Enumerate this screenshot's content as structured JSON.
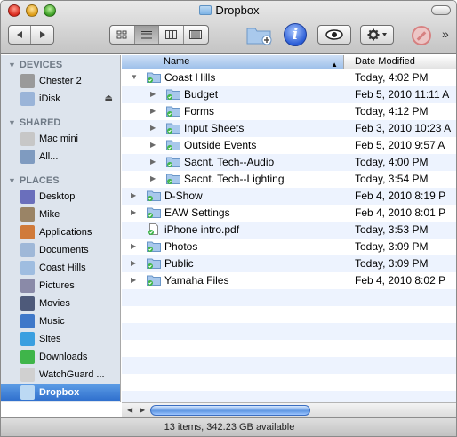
{
  "window": {
    "title": "Dropbox",
    "status": "13 items, 342.23 GB available"
  },
  "toolbar": {
    "back_icon": "triangle-left",
    "forward_icon": "triangle-right",
    "view_modes": [
      "icon-view",
      "list-view",
      "column-view",
      "cover-flow-view"
    ],
    "selected_view": "list-view",
    "more_label": "»"
  },
  "sidebar": {
    "sections": [
      {
        "heading": "DEVICES",
        "items": [
          {
            "label": "Chester 2",
            "icon": "hard-disk-icon",
            "color": "#9a9a9a"
          },
          {
            "label": "iDisk",
            "icon": "idisk-icon",
            "color": "#9ab4d8",
            "eject": "⏏"
          }
        ]
      },
      {
        "heading": "SHARED",
        "items": [
          {
            "label": "Mac mini",
            "icon": "mac-mini-icon",
            "color": "#c7c7c7"
          },
          {
            "label": "All...",
            "icon": "network-icon",
            "color": "#7f9bc0"
          }
        ]
      },
      {
        "heading": "PLACES",
        "items": [
          {
            "label": "Desktop",
            "icon": "desktop-icon",
            "color": "#6a6fbc"
          },
          {
            "label": "Mike",
            "icon": "home-icon",
            "color": "#9a8466"
          },
          {
            "label": "Applications",
            "icon": "applications-icon",
            "color": "#d07a3a"
          },
          {
            "label": "Documents",
            "icon": "documents-icon",
            "color": "#9fb8d8"
          },
          {
            "label": "Coast Hills",
            "icon": "folder-icon",
            "color": "#9fbde0"
          },
          {
            "label": "Pictures",
            "icon": "pictures-icon",
            "color": "#8a8aa8"
          },
          {
            "label": "Movies",
            "icon": "movies-icon",
            "color": "#4e5a7a"
          },
          {
            "label": "Music",
            "icon": "music-icon",
            "color": "#3f78c9"
          },
          {
            "label": "Sites",
            "icon": "sites-icon",
            "color": "#3a9fe0"
          },
          {
            "label": "Downloads",
            "icon": "downloads-icon",
            "color": "#3fb54a"
          },
          {
            "label": "WatchGuard ...",
            "icon": "watchguard-icon",
            "color": "#d0d0d0"
          },
          {
            "label": "Dropbox",
            "icon": "dropbox-icon",
            "color": "#bcd9f3",
            "selected": true
          }
        ]
      }
    ]
  },
  "list": {
    "columns": {
      "name": "Name",
      "date": "Date Modified"
    },
    "sort_arrow": "▲",
    "rows": [
      {
        "name": "Coast Hills",
        "date": "Today, 4:02 PM",
        "type": "folder",
        "expanded": true,
        "level": 0
      },
      {
        "name": "Budget",
        "date": "Feb 5, 2010 11:11 A",
        "type": "folder",
        "level": 1
      },
      {
        "name": "Forms",
        "date": "Today, 4:12 PM",
        "type": "folder",
        "level": 1
      },
      {
        "name": "Input Sheets",
        "date": "Feb 3, 2010 10:23 A",
        "type": "folder",
        "level": 1
      },
      {
        "name": "Outside Events",
        "date": "Feb 5, 2010 9:57 A",
        "type": "folder",
        "level": 1
      },
      {
        "name": "Sacnt. Tech--Audio",
        "date": "Today, 4:00 PM",
        "type": "folder",
        "level": 1
      },
      {
        "name": "Sacnt. Tech--Lighting",
        "date": "Today, 3:54 PM",
        "type": "folder",
        "level": 1
      },
      {
        "name": "D-Show",
        "date": "Feb 4, 2010 8:19 P",
        "type": "folder",
        "level": 0
      },
      {
        "name": "EAW Settings",
        "date": "Feb 4, 2010 8:01 P",
        "type": "folder",
        "level": 0
      },
      {
        "name": "iPhone intro.pdf",
        "date": "Today, 3:53 PM",
        "type": "file",
        "level": 0
      },
      {
        "name": "Photos",
        "date": "Today, 3:09 PM",
        "type": "folder",
        "level": 0
      },
      {
        "name": "Public",
        "date": "Today, 3:09 PM",
        "type": "folder",
        "level": 0
      },
      {
        "name": "Yamaha Files",
        "date": "Feb 4, 2010 8:02 P",
        "type": "folder",
        "level": 0
      }
    ]
  }
}
